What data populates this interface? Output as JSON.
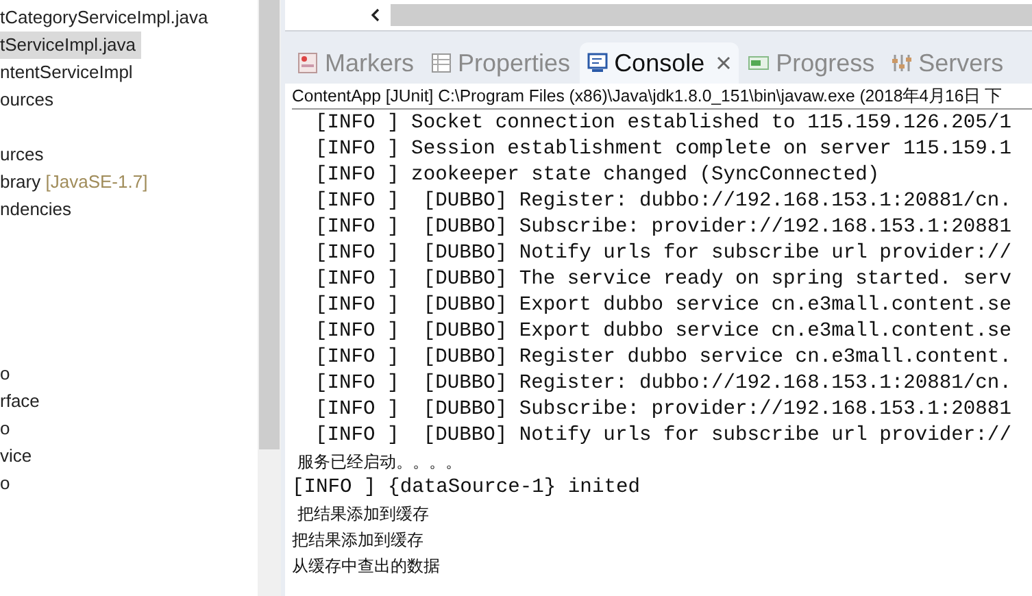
{
  "explorer": {
    "groups": [
      [
        {
          "label": "tCategoryServiceImpl.java",
          "selected": false
        },
        {
          "label": "tServiceImpl.java",
          "selected": true
        },
        {
          "label": "ntentServiceImpl",
          "selected": false
        },
        {
          "label": "ources",
          "selected": false
        }
      ],
      [
        {
          "label": "urces",
          "selected": false
        },
        {
          "label": "brary",
          "decoration": "[JavaSE-1.7]",
          "selected": false
        },
        {
          "label": "ndencies",
          "selected": false
        }
      ],
      [
        {
          "label": "o",
          "selected": false
        },
        {
          "label": "rface",
          "selected": false
        },
        {
          "label": "o",
          "selected": false
        },
        {
          "label": "vice",
          "selected": false
        },
        {
          "label": "o",
          "selected": false
        }
      ]
    ]
  },
  "tabs": [
    {
      "label": "Markers",
      "kind": "markers",
      "selected": false
    },
    {
      "label": "Properties",
      "kind": "properties",
      "selected": false
    },
    {
      "label": "Console",
      "kind": "console",
      "selected": true
    },
    {
      "label": "Progress",
      "kind": "progress",
      "selected": false
    },
    {
      "label": "Servers",
      "kind": "servers",
      "selected": false
    }
  ],
  "console": {
    "header": "ContentApp [JUnit] C:\\Program Files (x86)\\Java\\jdk1.8.0_151\\bin\\javaw.exe (2018年4月16日 下",
    "lines": [
      {
        "kind": "log",
        "text": "[INFO ] Socket connection established to 115.159.126.205/1"
      },
      {
        "kind": "log",
        "text": "[INFO ] Session establishment complete on server 115.159.1"
      },
      {
        "kind": "log",
        "text": "[INFO ] zookeeper state changed (SyncConnected)"
      },
      {
        "kind": "log",
        "text": "[INFO ]  [DUBBO] Register: dubbo://192.168.153.1:20881/cn."
      },
      {
        "kind": "log",
        "text": "[INFO ]  [DUBBO] Subscribe: provider://192.168.153.1:20881"
      },
      {
        "kind": "log",
        "text": "[INFO ]  [DUBBO] Notify urls for subscribe url provider://"
      },
      {
        "kind": "log",
        "text": "[INFO ]  [DUBBO] The service ready on spring started. serv"
      },
      {
        "kind": "log",
        "text": "[INFO ]  [DUBBO] Export dubbo service cn.e3mall.content.se"
      },
      {
        "kind": "log",
        "text": "[INFO ]  [DUBBO] Export dubbo service cn.e3mall.content.se"
      },
      {
        "kind": "log",
        "text": "[INFO ]  [DUBBO] Register dubbo service cn.e3mall.content."
      },
      {
        "kind": "log",
        "text": "[INFO ]  [DUBBO] Register: dubbo://192.168.153.1:20881/cn."
      },
      {
        "kind": "log",
        "text": "[INFO ]  [DUBBO] Subscribe: provider://192.168.153.1:20881"
      },
      {
        "kind": "log",
        "text": "[INFO ]  [DUBBO] Notify urls for subscribe url provider://"
      },
      {
        "kind": "text",
        "text": " 服务已经启动。。。。"
      },
      {
        "kind": "plain",
        "text": "[INFO ] {dataSource-1} inited"
      },
      {
        "kind": "text",
        "text": " 把结果添加到缓存"
      },
      {
        "kind": "text",
        "text": "把结果添加到缓存"
      },
      {
        "kind": "text",
        "text": "从缓存中查出的数据"
      }
    ]
  }
}
